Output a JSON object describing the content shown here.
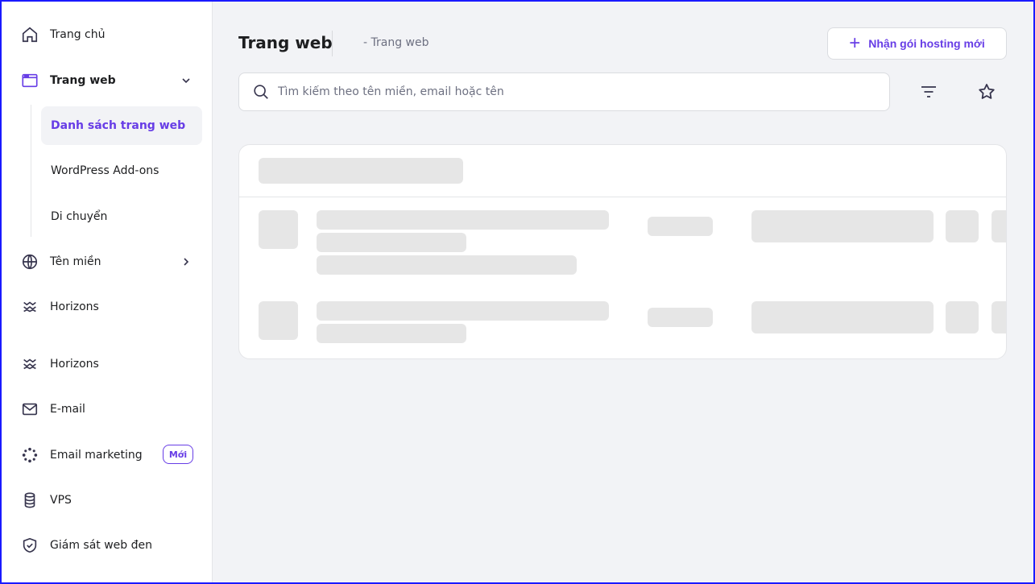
{
  "sidebar": {
    "items": [
      {
        "label": "Trang chủ",
        "icon": "home-icon"
      },
      {
        "label": "Trang web",
        "icon": "browser-window-icon"
      },
      {
        "label": "Tên miền",
        "icon": "globe-icon"
      },
      {
        "label": "Horizons",
        "icon": "waves-icon"
      },
      {
        "label": "Horizons",
        "icon": "waves-icon"
      },
      {
        "label": "E-mail",
        "icon": "mail-icon"
      },
      {
        "label": "Email marketing",
        "icon": "sparkle-loader-icon",
        "badge": "Mới"
      },
      {
        "label": "VPS",
        "icon": "database-icon"
      },
      {
        "label": "Giám sát web đen",
        "icon": "shield-check-icon"
      }
    ],
    "subitems": [
      {
        "label": "Danh sách trang web",
        "active": true
      },
      {
        "label": "WordPress Add-ons"
      },
      {
        "label": "Di chuyển"
      }
    ]
  },
  "header": {
    "title": "Trang web",
    "breadcrumb": "- Trang web",
    "hosting_button": "Nhận gói hosting mới",
    "hosting_button_icon": "plus-icon"
  },
  "search": {
    "placeholder": "Tìm kiếm theo tên miền, email hoặc tên",
    "value": ""
  },
  "toolbar": {
    "filter_icon": "filter-icon",
    "favorite_icon": "star-icon"
  },
  "colors": {
    "accent": "#673de6",
    "background": "#f2f3f6",
    "skeleton": "#e6e6e6"
  }
}
